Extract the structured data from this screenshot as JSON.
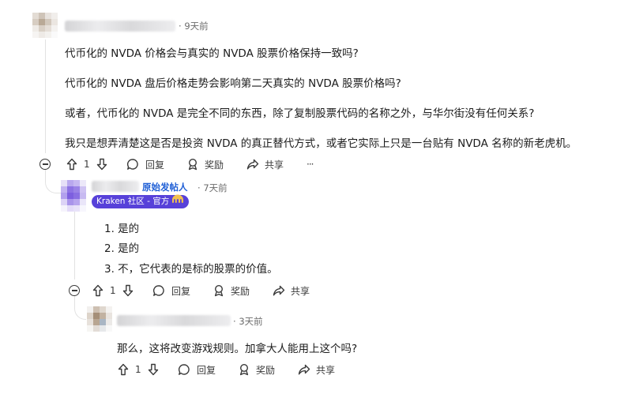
{
  "comments": [
    {
      "time": "9天前",
      "paragraphs": [
        "代币化的 NVDA 价格会与真实的 NVDA 股票价格保持一致吗?",
        "代币化的 NVDA 盘后价格走势会影响第二天真实的 NVDA 股票价格吗?",
        "或者，代币化的 NVDA 是完全不同的东西，除了复制股票代码的名称之外，与华尔街没有任何关系?",
        "我只是想弄清楚这是否是投资 NVDA 的真正替代方式，或者它实际上只是一台贴有 NVDA 名称的新老虎机。"
      ],
      "votes": "1",
      "reply_label": "回复",
      "award_label": "奖励",
      "share_label": "共享",
      "more_label": "···"
    },
    {
      "op_label": "原始发帖人",
      "time": "7天前",
      "badge": "Kraken 社区 - 官方",
      "list_items": [
        "是的",
        "是的",
        "不，它代表的是标的股票的价值。"
      ],
      "votes": "1",
      "reply_label": "回复",
      "award_label": "奖励",
      "share_label": "共享"
    },
    {
      "time": "3天前",
      "text": "那么，这将改变游戏规则。加拿大人能用上这个吗?",
      "votes": "1",
      "reply_label": "回复",
      "award_label": "奖励",
      "share_label": "共享"
    }
  ],
  "icons": [
    "upvote-icon",
    "downvote-icon",
    "reply-bubble-icon",
    "award-icon",
    "share-icon",
    "more-icon",
    "collapse-icon"
  ],
  "colors": {
    "badge_bg": "#5741d9",
    "op_text": "#1f5fd6",
    "thread_line": "#e2e2e2"
  }
}
